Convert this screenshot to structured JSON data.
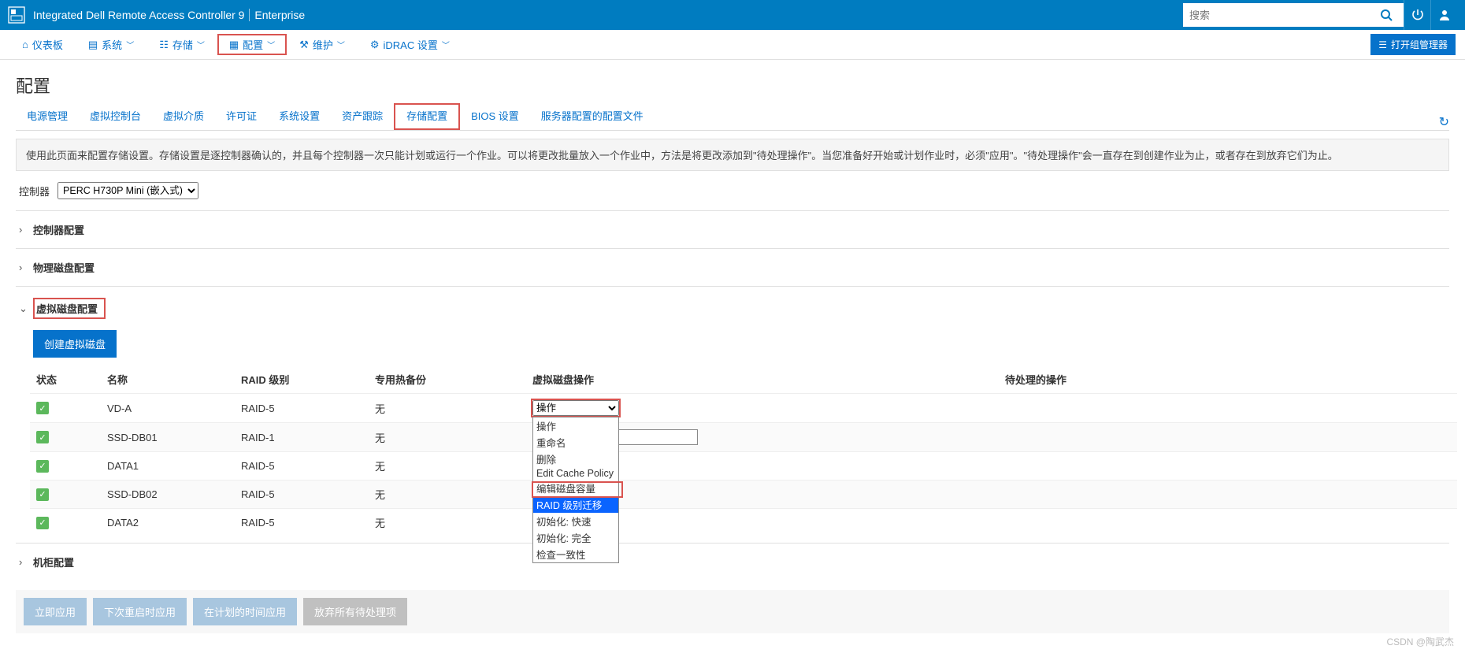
{
  "header": {
    "app_title": "Integrated Dell Remote Access Controller 9",
    "edition": "Enterprise",
    "search_placeholder": "搜索"
  },
  "nav": {
    "dashboard": "仪表板",
    "system": "系统",
    "storage": "存储",
    "configure": "配置",
    "maintain": "维护",
    "idrac": "iDRAC 设置",
    "group_mgr": "打开组管理器"
  },
  "page": {
    "title": "配置",
    "tabs": {
      "power": "电源管理",
      "vconsole": "虚拟控制台",
      "vmedia": "虚拟介质",
      "license": "许可证",
      "sys": "系统设置",
      "asset": "资产跟踪",
      "storage": "存储配置",
      "bios": "BIOS 设置",
      "profile": "服务器配置的配置文件"
    },
    "info": "使用此页面来配置存储设置。存储设置是逐控制器确认的，并且每个控制器一次只能计划或运行一个作业。可以将更改批量放入一个作业中，方法是将更改添加到\"待处理操作\"。当您准备好开始或计划作业时，必须\"应用\"。\"待处理操作\"会一直存在到创建作业为止，或者存在到放弃它们为止。"
  },
  "controller": {
    "label": "控制器",
    "selected": "PERC H730P Mini (嵌入式)"
  },
  "sections": {
    "controller_cfg": "控制器配置",
    "phys_disk": "物理磁盘配置",
    "virt_disk": "虚拟磁盘配置",
    "enclosure": "机柜配置"
  },
  "vd": {
    "create_btn": "创建虚拟磁盘",
    "headers": {
      "status": "状态",
      "name": "名称",
      "raid": "RAID 级别",
      "spare": "专用热备份",
      "op": "虚拟磁盘操作",
      "pending": "待处理的操作"
    },
    "rows": [
      {
        "name": "VD-A",
        "raid": "RAID-5",
        "spare": "无",
        "op": "操作"
      },
      {
        "name": "SSD-DB01",
        "raid": "RAID-1",
        "spare": "无",
        "op": ""
      },
      {
        "name": "DATA1",
        "raid": "RAID-5",
        "spare": "无",
        "op": ""
      },
      {
        "name": "SSD-DB02",
        "raid": "RAID-5",
        "spare": "无",
        "op": ""
      },
      {
        "name": "DATA2",
        "raid": "RAID-5",
        "spare": "无",
        "op": ""
      }
    ],
    "dropdown": {
      "op": "操作",
      "rename": "重命名",
      "delete": "删除",
      "edit_cache": "Edit Cache Policy",
      "edit_cap": "编辑磁盘容量",
      "raid_migrate": "RAID 级别迁移",
      "init_fast": "初始化: 快速",
      "init_full": "初始化: 完全",
      "check": "检查一致性"
    }
  },
  "footer": {
    "apply_now": "立即应用",
    "apply_reboot": "下次重启时应用",
    "apply_sched": "在计划的时间应用",
    "discard": "放弃所有待处理项"
  },
  "watermark": "CSDN @陶武杰"
}
